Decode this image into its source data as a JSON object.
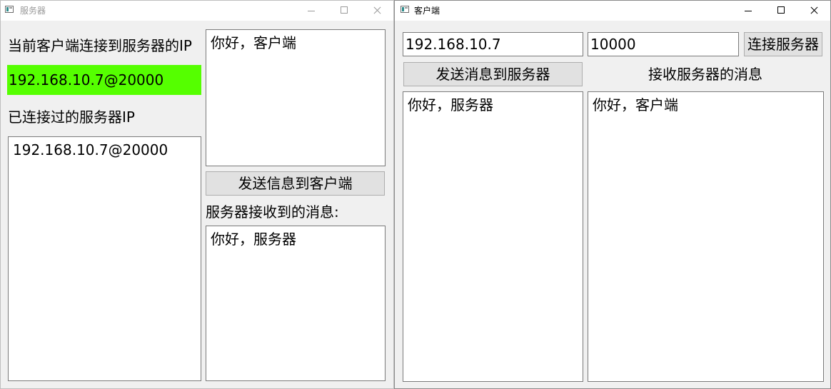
{
  "server": {
    "title": "服务器",
    "current_client_label": "当前客户端连接到服务器的IP",
    "current_client_value": "192.168.10.7@20000",
    "highlight_color": "#55ff00",
    "history_label": "已连接过的服务器IP",
    "history_items": [
      "192.168.10.7@20000"
    ],
    "send_text": "你好，客户端",
    "send_button": "发送信息到客户端",
    "received_label": "服务器接收到的消息:",
    "received_text": "你好，服务器"
  },
  "client": {
    "title": "客户端",
    "ip_value": "192.168.10.7",
    "port_value": "10000",
    "connect_button": "连接服务器",
    "send_button": "发送消息到服务器",
    "received_label": "接收服务器的消息",
    "send_text": "你好，服务器",
    "received_text": "你好，客户端"
  },
  "icons": {
    "app": "app-window-icon",
    "minimize": "minimize-icon",
    "maximize": "maximize-icon",
    "close": "close-icon"
  }
}
